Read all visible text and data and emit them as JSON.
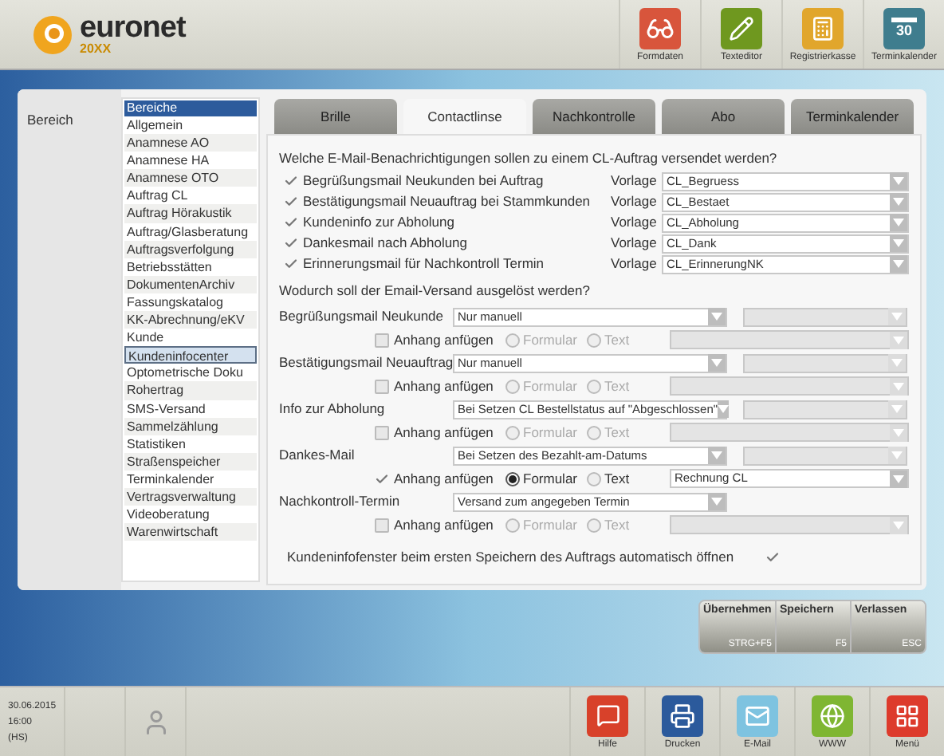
{
  "logo": {
    "name": "euronet",
    "edition": "20XX"
  },
  "toolbar": [
    {
      "label": "Formdaten",
      "kind": "glasses"
    },
    {
      "label": "Texteditor",
      "kind": "pencil"
    },
    {
      "label": "Registrierkasse",
      "kind": "register"
    },
    {
      "label": "Terminkalender",
      "kind": "calendar",
      "day": "30"
    }
  ],
  "sidebar": {
    "label": "Bereich",
    "list_header": "Bereiche",
    "items": [
      {
        "label": "Allgemein",
        "selected": false
      },
      {
        "label": "Anamnese AO",
        "selected": false
      },
      {
        "label": "Anamnese HA",
        "selected": false
      },
      {
        "label": "Anamnese OTO",
        "selected": false
      },
      {
        "label": "Auftrag CL",
        "selected": false
      },
      {
        "label": "Auftrag Hörakustik",
        "selected": false
      },
      {
        "label": "Auftrag/Glasberatung",
        "selected": false
      },
      {
        "label": "Auftragsverfolgung",
        "selected": false
      },
      {
        "label": "Betriebsstätten",
        "selected": false
      },
      {
        "label": "DokumentenArchiv",
        "selected": false
      },
      {
        "label": "Fassungskatalog",
        "selected": false
      },
      {
        "label": "KK-Abrechnung/eKV",
        "selected": false
      },
      {
        "label": "Kunde",
        "selected": false
      },
      {
        "label": "Kundeninfocenter",
        "selected": true
      },
      {
        "label": "Optometrische Doku",
        "selected": false
      },
      {
        "label": "Rohertrag",
        "selected": false
      },
      {
        "label": "SMS-Versand",
        "selected": false
      },
      {
        "label": "Sammelzählung",
        "selected": false
      },
      {
        "label": "Statistiken",
        "selected": false
      },
      {
        "label": "Straßenspeicher",
        "selected": false
      },
      {
        "label": "Terminkalender",
        "selected": false
      },
      {
        "label": "Vertragsverwaltung",
        "selected": false
      },
      {
        "label": "Videoberatung",
        "selected": false
      },
      {
        "label": "Warenwirtschaft",
        "selected": false
      }
    ]
  },
  "tabs": [
    {
      "label": "Brille",
      "selected": false
    },
    {
      "label": "Contactlinse",
      "selected": true
    },
    {
      "label": "Nachkontrolle",
      "selected": false
    },
    {
      "label": "Abo",
      "selected": false
    },
    {
      "label": "Terminkalender",
      "selected": false
    }
  ],
  "notifications_question": "Welche E-Mail-Benachrichtigungen sollen zu einem CL-Auftrag versendet werden?",
  "notifications": [
    {
      "label": "Begrüßungsmail Neukunden bei Auftrag",
      "checked": true,
      "template_label": "Vorlage",
      "template": "CL_Begruess"
    },
    {
      "label": "Bestätigungsmail Neuauftrag bei Stammkunden",
      "checked": true,
      "template_label": "Vorlage",
      "template": "CL_Bestaet"
    },
    {
      "label": "Kundeninfo zur Abholung",
      "checked": true,
      "template_label": "Vorlage",
      "template": "CL_Abholung"
    },
    {
      "label": "Dankesmail nach Abholung",
      "checked": true,
      "template_label": "Vorlage",
      "template": "CL_Dank"
    },
    {
      "label": "Erinnerungsmail für Nachkontroll Termin",
      "checked": true,
      "template_label": "Vorlage",
      "template": "CL_ErinnerungNK"
    }
  ],
  "trigger_question": "Wodurch soll der Email-Versand ausgelöst werden?",
  "triggers": [
    {
      "label": "Begrüßungsmail Neukunde",
      "trigger": "Nur manuell",
      "side_select": true,
      "attachment": {
        "label": "Anhang anfügen",
        "checked": false,
        "options": [
          {
            "label": "Formular",
            "selected": false
          },
          {
            "label": "Text",
            "selected": false
          }
        ]
      }
    },
    {
      "label": "Bestätigungsmail Neuauftrag",
      "trigger": "Nur manuell",
      "side_select": true,
      "attachment": {
        "label": "Anhang anfügen",
        "checked": false,
        "options": [
          {
            "label": "Formular",
            "selected": false
          },
          {
            "label": "Text",
            "selected": false
          }
        ]
      }
    },
    {
      "label": "Info zur Abholung",
      "trigger": "Bei Setzen CL Bestellstatus auf \"Abgeschlossen\"",
      "side_select": true,
      "attachment": {
        "label": "Anhang anfügen",
        "checked": false,
        "options": [
          {
            "label": "Formular",
            "selected": false
          },
          {
            "label": "Text",
            "selected": false
          }
        ]
      }
    },
    {
      "label": "Dankes-Mail",
      "trigger": "Bei Setzen des Bezahlt-am-Datums",
      "side_select": true,
      "attachment": {
        "label": "Anhang anfügen",
        "checked": true,
        "options": [
          {
            "label": "Formular",
            "selected": true
          },
          {
            "label": "Text",
            "selected": false
          }
        ],
        "template": "Rechnung CL"
      }
    },
    {
      "label": "Nachkontroll-Termin",
      "trigger": "Versand zum angegeben Termin",
      "side_select": false,
      "attachment": {
        "label": "Anhang anfügen",
        "checked": false,
        "options": [
          {
            "label": "Formular",
            "selected": false
          },
          {
            "label": "Text",
            "selected": false
          }
        ]
      }
    }
  ],
  "auto_open": {
    "label": "Kundeninfofenster beim ersten Speichern des Auftrags automatisch öffnen",
    "checked": true
  },
  "actions": [
    {
      "label": "Übernehmen",
      "shortcut": "STRG+F5"
    },
    {
      "label": "Speichern",
      "shortcut": "F5"
    },
    {
      "label": "Verlassen",
      "shortcut": "ESC"
    }
  ],
  "status": {
    "date": "30.06.2015",
    "time": "16:00",
    "user": "(HS)"
  },
  "footer_buttons": [
    {
      "label": "Hilfe",
      "kind": "help"
    },
    {
      "label": "Drucken",
      "kind": "print"
    },
    {
      "label": "E-Mail",
      "kind": "mail"
    },
    {
      "label": "WWW",
      "kind": "web"
    },
    {
      "label": "Menü",
      "kind": "menu"
    }
  ]
}
